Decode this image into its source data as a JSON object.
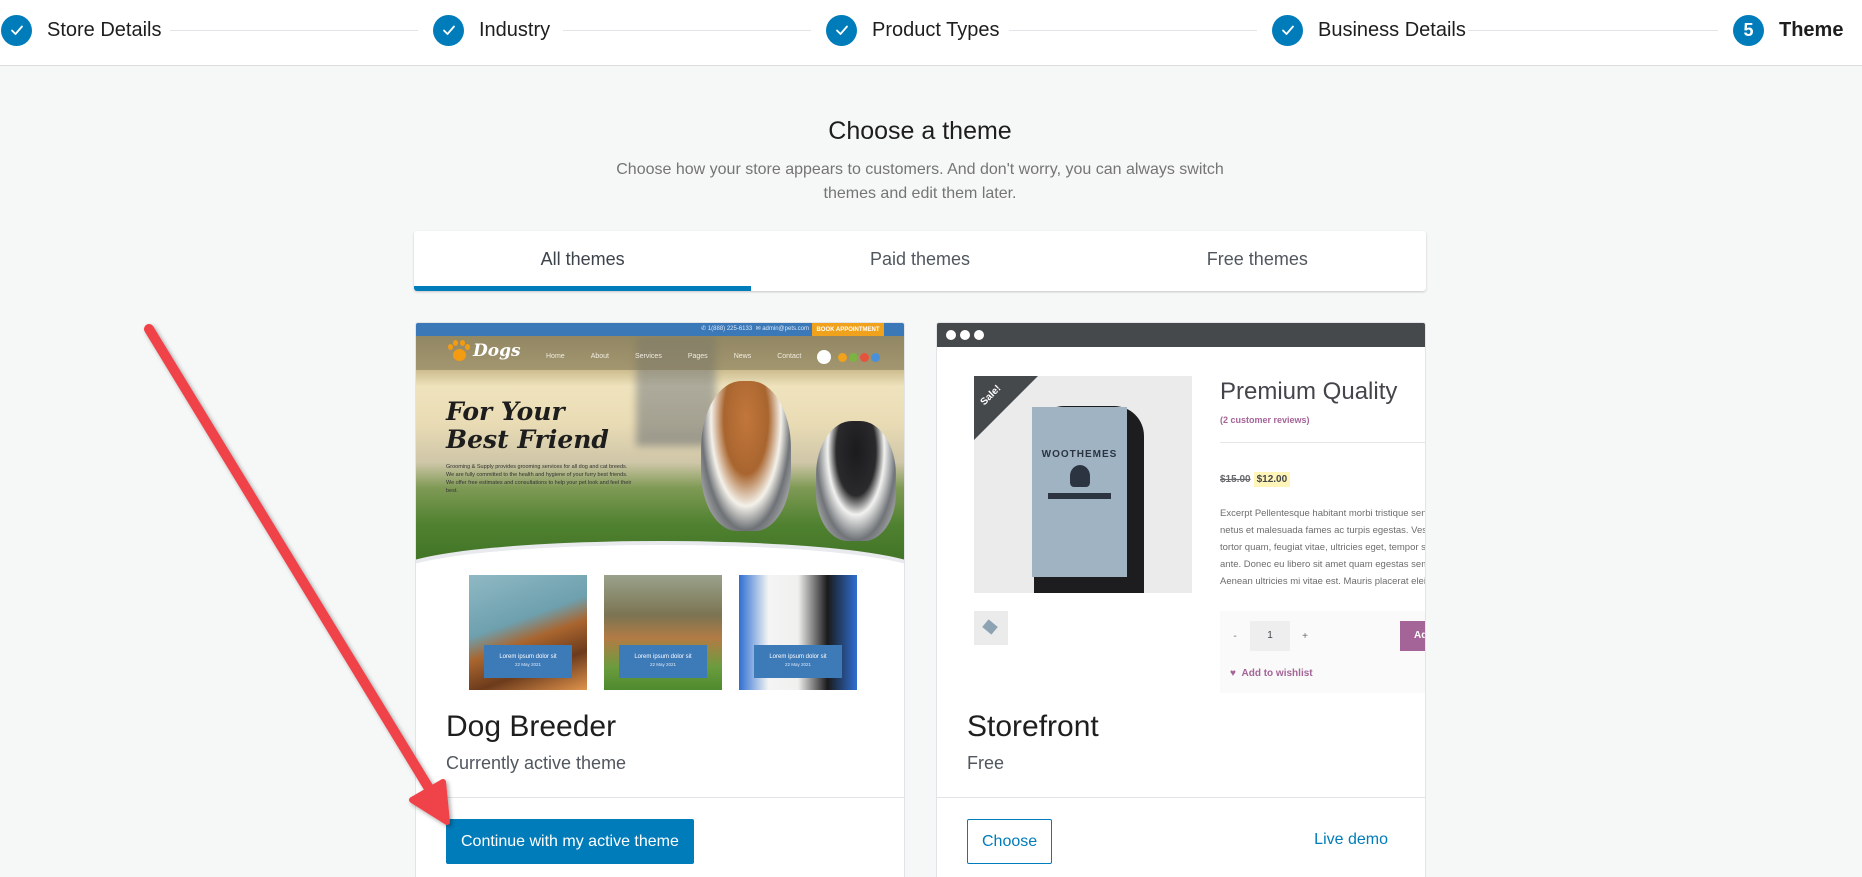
{
  "stepper": {
    "steps": [
      {
        "label": "Store Details",
        "status": "complete",
        "marker": "check-icon"
      },
      {
        "label": "Industry",
        "status": "complete",
        "marker": "check-icon"
      },
      {
        "label": "Product Types",
        "status": "complete",
        "marker": "check-icon"
      },
      {
        "label": "Business Details",
        "status": "complete",
        "marker": "check-icon"
      },
      {
        "label": "Theme",
        "status": "current",
        "marker": "5"
      }
    ]
  },
  "heading": {
    "title": "Choose a theme",
    "subtitle": "Choose how your store appears to customers. And don't worry, you can always switch themes and edit them later."
  },
  "tabs": [
    {
      "label": "All themes",
      "active": true
    },
    {
      "label": "Paid themes",
      "active": false
    },
    {
      "label": "Free themes",
      "active": false
    }
  ],
  "themes": [
    {
      "name": "Dog Breeder",
      "status": "Currently active theme",
      "primary_action": "Continue with my active theme",
      "preview": {
        "phone": "1(888) 225-6133",
        "email": "admin@pets.com",
        "book_label": "BOOK APPOINTMENT",
        "logo": "Dogs",
        "menu": [
          "Home",
          "About",
          "Services",
          "Pages",
          "News",
          "Contact"
        ],
        "headline_1": "For Your",
        "headline_2": "Best Friend",
        "blurb": "Grooming & Supply provides grooming services for all dog and cat breeds. We are fully committed to the health and hygiene of your furry best friends. We offer free estimates and consultations to help your pet look and feel their best.",
        "tiles": [
          {
            "caption": "Lorem ipsum dolor sit",
            "date": "22 May 2021"
          },
          {
            "caption": "Lorem ipsum dolor sit",
            "date": "22 May 2021"
          },
          {
            "caption": "Lorem ipsum dolor sit",
            "date": "22 May 2021"
          }
        ]
      }
    },
    {
      "name": "Storefront",
      "status": "Free",
      "primary_action": "Choose",
      "secondary_action": "Live demo",
      "preview": {
        "sale_badge": "Sale!",
        "poster_brand": "WOOTHEMES",
        "product_title": "Premium Quality",
        "reviews": "(2 customer reviews)",
        "old_price": "$15.00",
        "new_price": "$12.00",
        "excerpt": [
          "Excerpt Pellentesque habitant morbi tristique senectus et",
          "netus et malesuada fames ac turpis egestas. Vestibulum",
          "tortor quam, feugiat vitae, ultricies eget, tempor sit amet,",
          "ante. Donec eu libero sit amet quam egestas semper.",
          "Aenean ultricies mi vitae est. Mauris placerat eleifend leo."
        ],
        "qty_minus": "-",
        "qty_value": "1",
        "qty_plus": "+",
        "add_to_cart": "Add to cart",
        "wishlist": "Add to wishlist"
      }
    }
  ],
  "colors": {
    "accent": "#007cba",
    "annotation_arrow": "#f0434a",
    "woo_purple": "#a46497",
    "dog_blue": "#3b78b8",
    "dog_orange": "#f0a21c"
  }
}
